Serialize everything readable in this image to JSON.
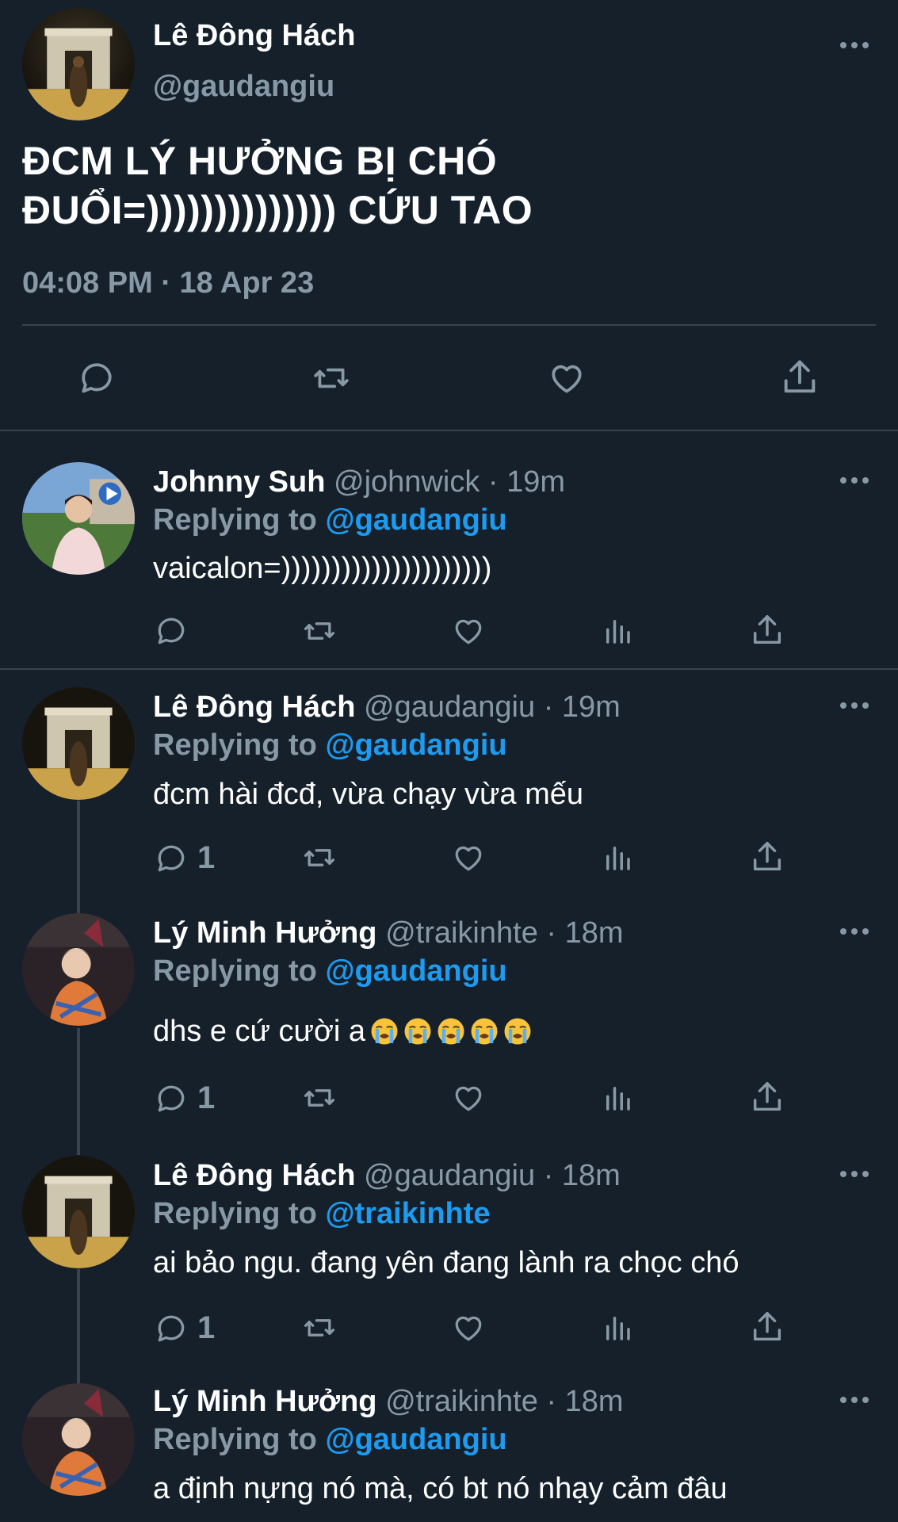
{
  "main": {
    "author_name": "Lê Đông Hách",
    "author_handle": "@gaudangiu",
    "text_line1": "ĐCM LÝ HƯỞNG BỊ CHÓ",
    "text_line2": "ĐUỔI=)))))))))))))) CỨU TAO",
    "timestamp": "04:08 PM · 18 Apr 23"
  },
  "replies": [
    {
      "name": "Johnny Suh",
      "handle": "@johnwick",
      "time": "· 19m",
      "replying_label": "Replying to",
      "replying_to": "@gaudangiu",
      "text": "vaicalon=)))))))))))))))))))))",
      "reply_count": ""
    },
    {
      "name": "Lê Đông Hách",
      "handle": "@gaudangiu",
      "time": "· 19m",
      "replying_label": "Replying to",
      "replying_to": "@gaudangiu",
      "text": "đcm hài đcđ, vừa chạy vừa mếu",
      "reply_count": "1"
    },
    {
      "name": "Lý Minh Hưởng",
      "handle": "@traikinhte",
      "time": "· 18m",
      "replying_label": "Replying to",
      "replying_to": "@gaudangiu",
      "text": "dhs e cứ cười a",
      "emojis": "😭 😭 😭 😭 😭",
      "reply_count": "1"
    },
    {
      "name": "Lê Đông Hách",
      "handle": "@gaudangiu",
      "time": "· 18m",
      "replying_label": "Replying to",
      "replying_to": "@traikinhte",
      "text": "ai bảo ngu. đang yên đang lành ra chọc chó",
      "reply_count": "1"
    },
    {
      "name": "Lý Minh Hưởng",
      "handle": "@traikinhte",
      "time": "· 18m",
      "replying_label": "Replying to",
      "replying_to": "@gaudangiu",
      "text": "a định nựng nó mà, có bt nó nhạy cảm đâu",
      "reply_count": ""
    }
  ],
  "colors": {
    "background": "#15202b",
    "muted": "#8899a6",
    "link": "#1d9bf0",
    "divider": "#38444d"
  },
  "icons": [
    "reply-icon",
    "retweet-icon",
    "like-icon",
    "analytics-icon",
    "share-icon",
    "more-icon"
  ]
}
